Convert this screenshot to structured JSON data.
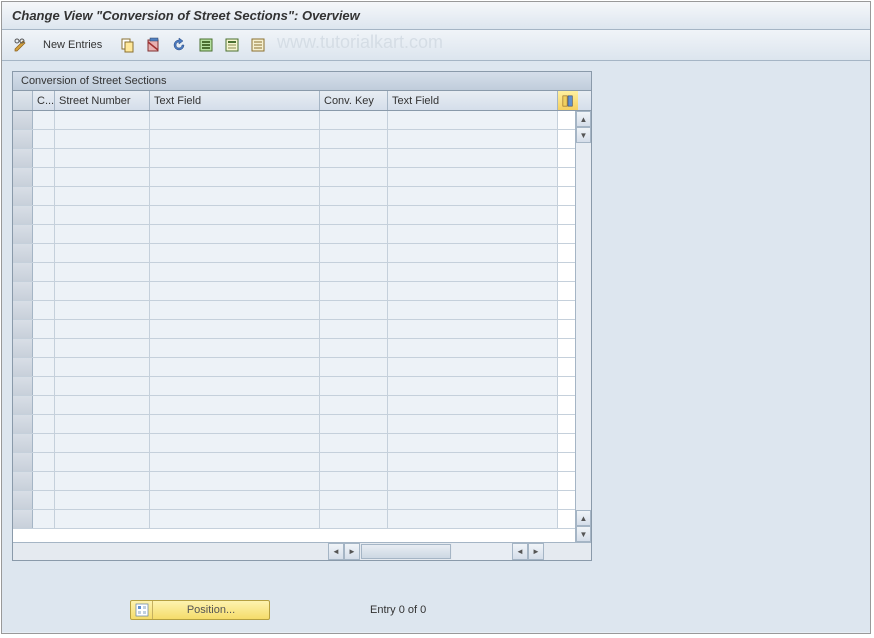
{
  "title": "Change View \"Conversion of Street Sections\": Overview",
  "toolbar": {
    "new_entries_label": "New Entries"
  },
  "watermark": "www.tutorialkart.com",
  "grid": {
    "title": "Conversion of Street Sections",
    "columns": {
      "c": "C...",
      "street_number": "Street Number",
      "text1": "Text Field",
      "conv_key": "Conv. Key",
      "text2": "Text Field"
    },
    "rows": [
      {},
      {},
      {},
      {},
      {},
      {},
      {},
      {},
      {},
      {},
      {},
      {},
      {},
      {},
      {},
      {},
      {},
      {},
      {},
      {},
      {},
      {}
    ]
  },
  "footer": {
    "position_label": "Position...",
    "entry_status": "Entry 0 of 0"
  }
}
